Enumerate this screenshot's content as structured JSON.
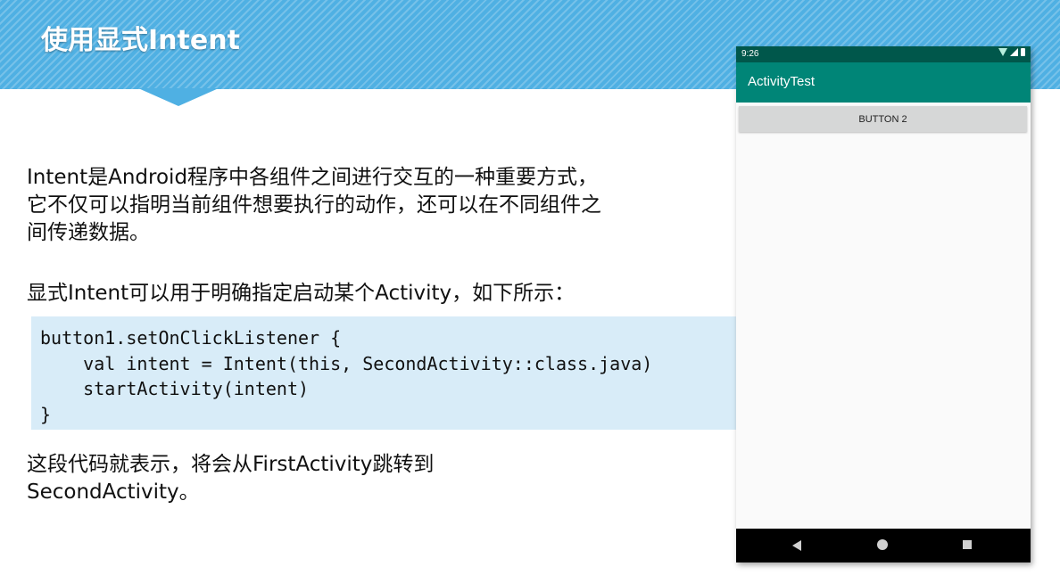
{
  "slide": {
    "title": "使用显式Intent",
    "paragraph1": "Intent是Android程序中各组件之间进行交互的一种重要方式，它不仅可以指明当前组件想要执行的动作，还可以在不同组件之间传递数据。",
    "paragraph2": "显式Intent可以用于明确指定启动某个Activity，如下所示：",
    "code": "button1.setOnClickListener {\n    val intent = Intent(this, SecondActivity::class.java)\n    startActivity(intent)\n}",
    "paragraph3": "这段代码就表示，将会从FirstActivity跳转到SecondActivity。"
  },
  "phone": {
    "status_time": "9:26",
    "status_icons": [
      "wifi-icon",
      "signal-icon",
      "battery-icon"
    ],
    "app_title": "ActivityTest",
    "button_label": "BUTTON 2",
    "nav_icons": [
      "back-icon",
      "home-icon",
      "recents-icon"
    ],
    "colors": {
      "status_bar": "#00574b",
      "app_bar": "#008577",
      "header_band": "#4fb0e3",
      "code_background": "#d8ecf8"
    }
  }
}
